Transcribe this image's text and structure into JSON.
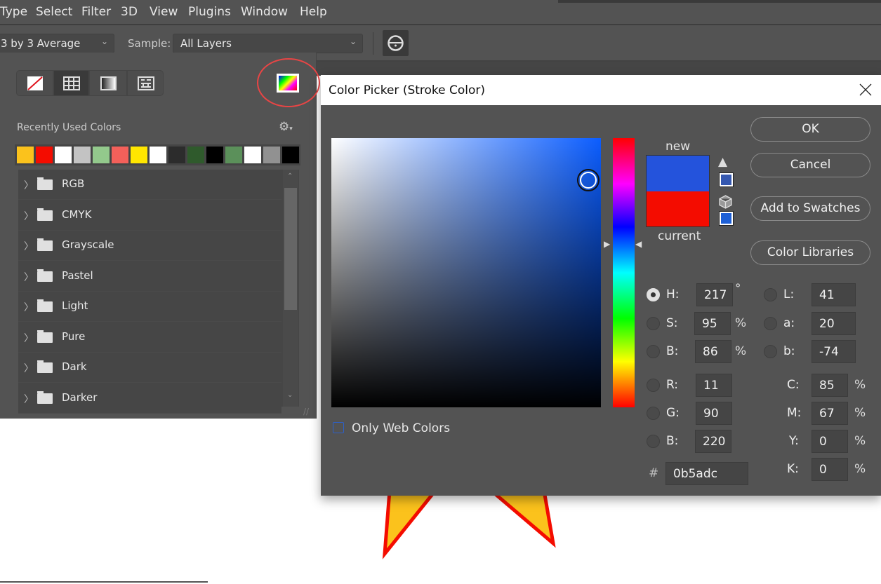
{
  "menubar": {
    "items": [
      "Type",
      "Select",
      "Filter",
      "3D",
      "View",
      "Plugins",
      "Window",
      "Help"
    ]
  },
  "options": {
    "sample_size": "3 by 3 Average",
    "sample_label": "Sample:",
    "sample_value": "All Layers"
  },
  "swatch_panel": {
    "recent_label": "Recently Used Colors",
    "recent_colors": [
      "#fbc21c",
      "#f40c00",
      "#ffffff",
      "#c3c3c3",
      "#93c98c",
      "#f4605a",
      "#ffe600",
      "#ffffff",
      "#2c2c2c",
      "#2f5a2c",
      "#000000",
      "#5b905a",
      "#ffffff",
      "#919191",
      "#000000"
    ],
    "groups": [
      "RGB",
      "CMYK",
      "Grayscale",
      "Pastel",
      "Light",
      "Pure",
      "Dark",
      "Darker"
    ]
  },
  "dialog": {
    "title": "Color Picker (Stroke Color)",
    "buttons": {
      "ok": "OK",
      "cancel": "Cancel",
      "add": "Add to Swatches",
      "libraries": "Color Libraries"
    },
    "new_label": "new",
    "current_label": "current",
    "new_color": "#0b5adc",
    "current_color": "#f40c00",
    "hue_color": "#0b5dff",
    "only_web_colors": "Only Web Colors",
    "fields": {
      "H": {
        "label": "H:",
        "value": "217",
        "unit": "°",
        "selected": true
      },
      "S": {
        "label": "S:",
        "value": "95",
        "unit": "%"
      },
      "Bv": {
        "label": "B:",
        "value": "86",
        "unit": "%"
      },
      "R": {
        "label": "R:",
        "value": "11"
      },
      "G": {
        "label": "G:",
        "value": "90"
      },
      "Bc": {
        "label": "B:",
        "value": "220"
      },
      "L": {
        "label": "L:",
        "value": "41"
      },
      "a": {
        "label": "a:",
        "value": "20"
      },
      "b": {
        "label": "b:",
        "value": "-74"
      },
      "C": {
        "label": "C:",
        "value": "85",
        "unit": "%"
      },
      "M": {
        "label": "M:",
        "value": "67",
        "unit": "%"
      },
      "Y": {
        "label": "Y:",
        "value": "0",
        "unit": "%"
      },
      "K": {
        "label": "K:",
        "value": "0",
        "unit": "%"
      },
      "hex": {
        "label": "#",
        "value": "0b5adc"
      }
    }
  }
}
